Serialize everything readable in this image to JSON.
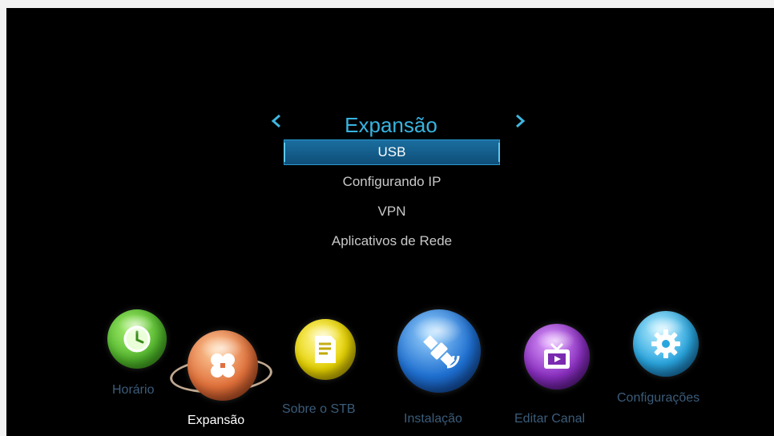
{
  "header": {
    "title": "Expansão",
    "prev_arrow": "◀",
    "next_arrow": "▶"
  },
  "menu": {
    "items": [
      {
        "label": "USB",
        "selected": true
      },
      {
        "label": "Configurando IP",
        "selected": false
      },
      {
        "label": "VPN",
        "selected": false
      },
      {
        "label": "Aplicativos de Rede",
        "selected": false
      }
    ]
  },
  "dock": {
    "items": [
      {
        "label": "Horário",
        "icon": "clock-icon",
        "color": "#5cc43a",
        "active": false
      },
      {
        "label": "Expansão",
        "icon": "expansion-icon",
        "color": "#e0703a",
        "active": true
      },
      {
        "label": "Sobre o STB",
        "icon": "document-icon",
        "color": "#e8d400",
        "active": false
      },
      {
        "label": "Instalação",
        "icon": "satellite-icon",
        "color": "#1e6fd0",
        "active": false
      },
      {
        "label": "Editar Canal",
        "icon": "tv-icon",
        "color": "#8a2fc0",
        "active": false
      },
      {
        "label": "Configurações",
        "icon": "gear-icon",
        "color": "#2aa6df",
        "active": false
      }
    ]
  }
}
